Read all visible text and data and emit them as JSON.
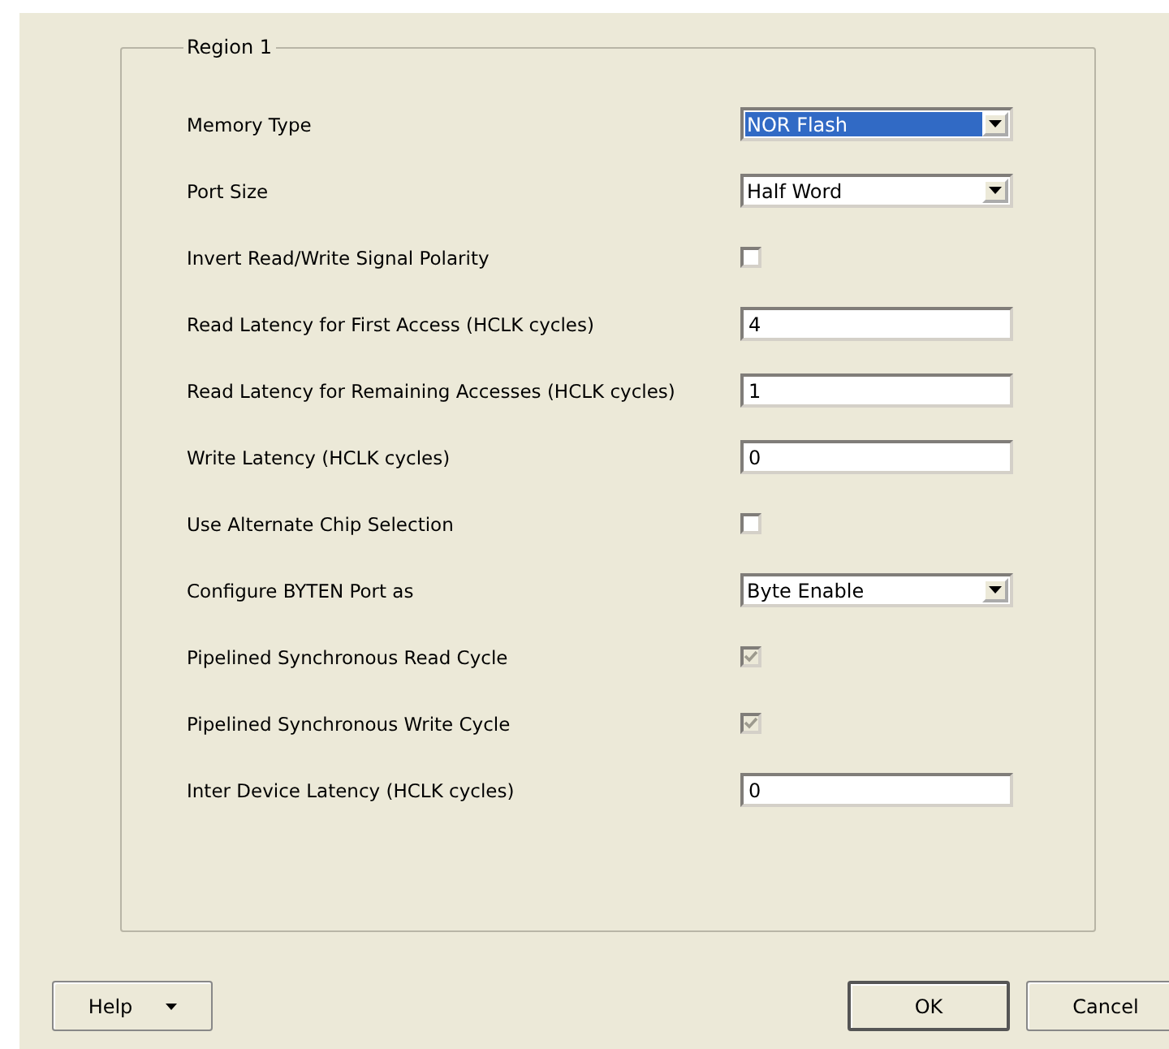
{
  "group": {
    "title": "Region 1"
  },
  "fields": [
    {
      "kind": "dropdown",
      "label": "Memory Type",
      "value": "NOR Flash",
      "highlighted": true
    },
    {
      "kind": "dropdown",
      "label": "Port Size",
      "value": "Half Word",
      "highlighted": false
    },
    {
      "kind": "checkbox",
      "label": "Invert Read/Write Signal Polarity",
      "checked": false,
      "disabled": false
    },
    {
      "kind": "text",
      "label": "Read Latency for First Access (HCLK cycles)",
      "value": "4"
    },
    {
      "kind": "text",
      "label": "Read Latency for Remaining Accesses (HCLK cycles)",
      "value": "1"
    },
    {
      "kind": "text",
      "label": "Write Latency (HCLK cycles)",
      "value": "0"
    },
    {
      "kind": "checkbox",
      "label": "Use Alternate Chip Selection",
      "checked": false,
      "disabled": false
    },
    {
      "kind": "dropdown",
      "label": "Configure BYTEN Port as",
      "value": "Byte Enable",
      "highlighted": false
    },
    {
      "kind": "checkbox",
      "label": "Pipelined Synchronous Read Cycle",
      "checked": true,
      "disabled": true
    },
    {
      "kind": "checkbox",
      "label": "Pipelined Synchronous Write Cycle",
      "checked": true,
      "disabled": true
    },
    {
      "kind": "text",
      "label": "Inter Device Latency (HCLK cycles)",
      "value": "0"
    }
  ],
  "buttons": [
    {
      "kind": "menu",
      "label": "Help",
      "default": false
    },
    {
      "kind": "plain",
      "label": "OK",
      "default": true
    },
    {
      "kind": "plain",
      "label": "Cancel",
      "default": false
    }
  ]
}
